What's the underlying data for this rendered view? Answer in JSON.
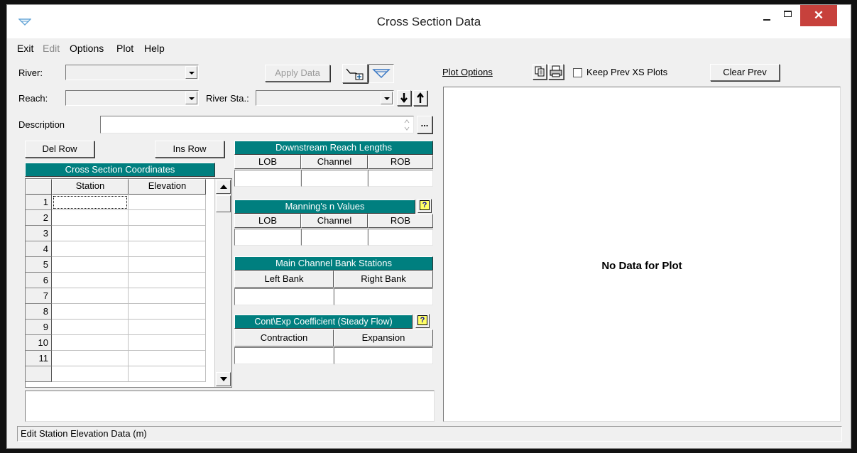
{
  "window": {
    "title": "Cross Section Data",
    "close_glyph": "✕"
  },
  "menu": [
    "Exit",
    "Edit",
    "Options",
    "Plot",
    "Help"
  ],
  "menu_disabled": [
    "Edit"
  ],
  "river": {
    "label": "River:",
    "value": ""
  },
  "reach": {
    "label": "Reach:",
    "value": ""
  },
  "river_sta": {
    "label": "River Sta.:",
    "value": ""
  },
  "toolbar": {
    "apply_data": "Apply Data",
    "ellipsis": "..."
  },
  "description": {
    "label": "Description",
    "value": ""
  },
  "grid_buttons": {
    "del_row": "Del Row",
    "ins_row": "Ins Row"
  },
  "xs_coords": {
    "title": "Cross Section Coordinates",
    "columns": [
      "Station",
      "Elevation"
    ],
    "rows": [
      "1",
      "2",
      "3",
      "4",
      "5",
      "6",
      "7",
      "8",
      "9",
      "10",
      "11"
    ]
  },
  "downstream_reach_lengths": {
    "title": "Downstream Reach Lengths",
    "columns": [
      "LOB",
      "Channel",
      "ROB"
    ]
  },
  "mannings_n": {
    "title": "Manning's n Values",
    "columns": [
      "LOB",
      "Channel",
      "ROB"
    ]
  },
  "bank_stations": {
    "title": "Main Channel Bank Stations",
    "columns": [
      "Left Bank",
      "Right Bank"
    ]
  },
  "cont_exp": {
    "title": "Cont\\Exp Coefficient (Steady Flow)",
    "columns": [
      "Contraction",
      "Expansion"
    ]
  },
  "plot": {
    "options_label": "Plot Options",
    "keep_prev_label": "Keep Prev XS Plots",
    "keep_prev_checked": false,
    "clear_prev": "Clear Prev",
    "no_data": "No Data for Plot"
  },
  "status": "Edit Station Elevation Data (m)",
  "colors": {
    "header_teal": "#007f7f",
    "close_red": "#c7413c"
  }
}
